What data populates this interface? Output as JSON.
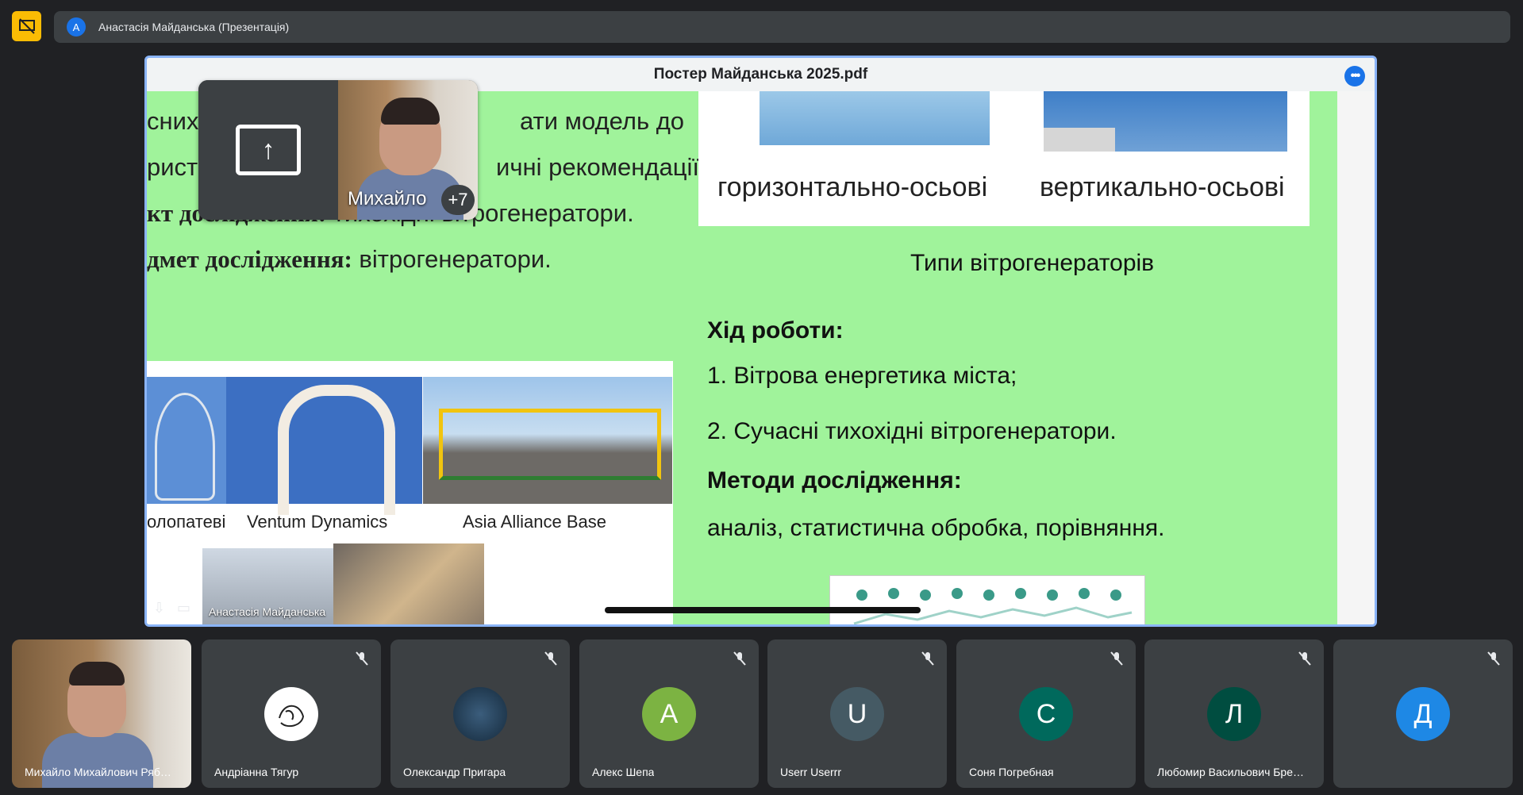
{
  "top": {
    "presenter_initial": "А",
    "presenter_label": "Анастасія Майданська (Презентація)"
  },
  "document": {
    "title": "Постер Майданська 2025.pdf",
    "left_text": {
      "line1": "сних",
      "line1b": "ати модель до",
      "line2": "рист",
      "line2b": "ичні рекомендації.",
      "line3_bold": "кт дослідження:",
      "line3": " тихохідні вітрогенератори.",
      "line4_bold": "дмет дослідження:",
      "line4": " вітрогенератори."
    },
    "types": {
      "horizontal": "горизонтально-осьові",
      "vertical": "вертикально-осьові",
      "caption": "Типи вітрогенераторів"
    },
    "work": {
      "heading": "Хід роботи:",
      "item1": "1. Вітрова енергетика міста;",
      "item2": "2. Сучасні тихохідні вітрогенератори.",
      "methods_heading": "Методи дослідження:",
      "methods": "аналіз, статистична обробка, порівняння."
    },
    "collage": {
      "cap1": "олопатеві",
      "cap2": "Ventum Dynamics",
      "cap3": "Asia Alliance Base"
    },
    "owner_label": "Анастасія Майданська"
  },
  "float": {
    "name": "Михайло",
    "extra": "+7"
  },
  "participants": [
    {
      "name": "Михайло Михайлович Ряб…",
      "initial": "",
      "color": ""
    },
    {
      "name": "Андріанна Тягур",
      "initial": "",
      "color": "#ffffff"
    },
    {
      "name": "Олександр Пригара",
      "initial": "",
      "color": "#1e3a52"
    },
    {
      "name": "Алекс Шепа",
      "initial": "А",
      "color": "#7cb342"
    },
    {
      "name": "Userr Userrr",
      "initial": "U",
      "color": "#455a64"
    },
    {
      "name": "Соня Погребная",
      "initial": "С",
      "color": "#00695c"
    },
    {
      "name": "Любомир Васильович Бре…",
      "initial": "Л",
      "color": "#004d40"
    },
    {
      "name": "",
      "initial": "Д",
      "color": "#1e88e5"
    }
  ]
}
